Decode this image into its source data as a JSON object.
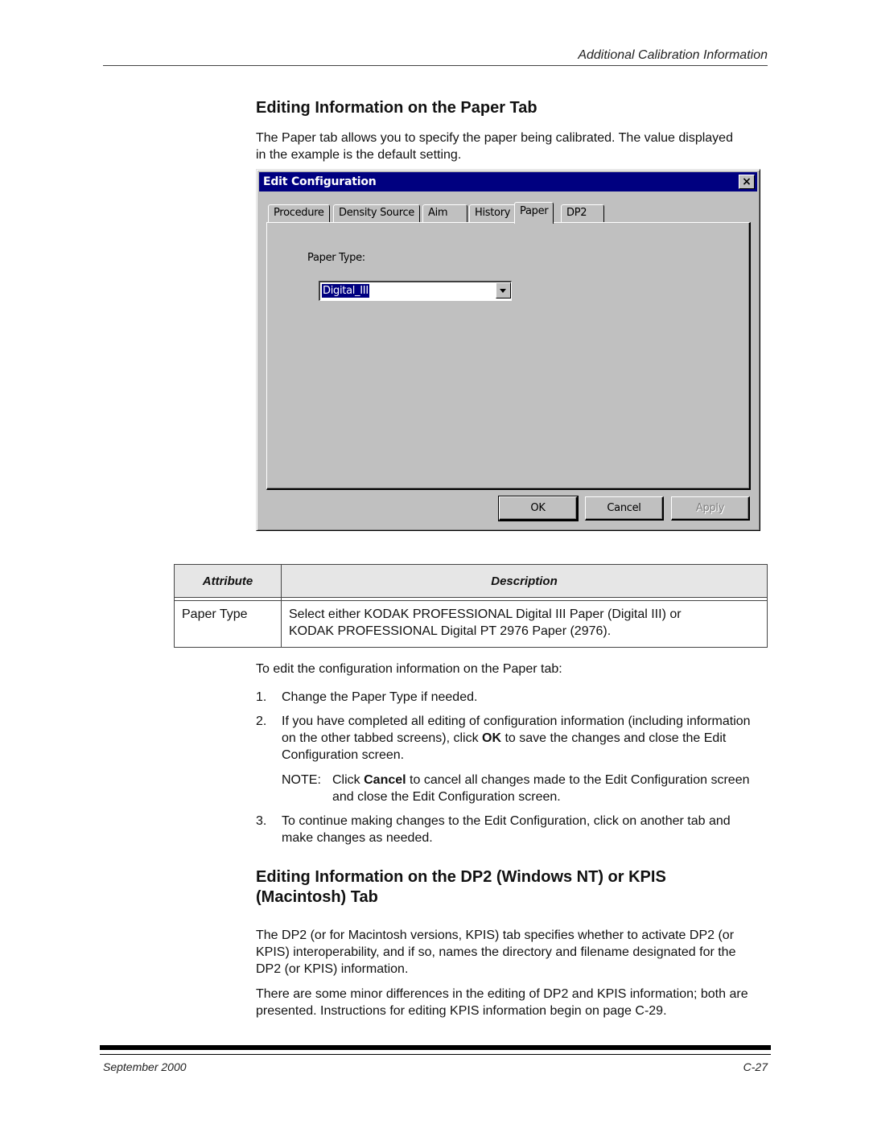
{
  "header": {
    "running_head": "Additional Calibration Information"
  },
  "section1": {
    "heading": "Editing Information on the Paper Tab",
    "intro": "The Paper tab allows you to specify the paper being calibrated. The value displayed in the example is the default setting."
  },
  "dialog": {
    "title": "Edit Configuration",
    "close_glyph": "×",
    "tabs": [
      {
        "label": "Procedure",
        "active": false
      },
      {
        "label": "Density Source",
        "active": false
      },
      {
        "label": "Aim",
        "active": false
      },
      {
        "label": "History",
        "active": false
      },
      {
        "label": "Paper",
        "active": true
      },
      {
        "label": "DP2",
        "active": false
      }
    ],
    "field_label": "Paper Type:",
    "paper_type_value": "Digital_III",
    "buttons": {
      "ok": "OK",
      "cancel": "Cancel",
      "apply": "Apply"
    },
    "colors": {
      "titlebar": "#000080",
      "face": "#c0c0c0",
      "selection": "#000080"
    }
  },
  "attribute_table": {
    "headers": [
      "Attribute",
      "Description"
    ],
    "rows": [
      {
        "attribute": "Paper Type",
        "description_line1": "Select either KODAK PROFESSIONAL Digital III Paper (Digital III) or",
        "description_line2": "KODAK PROFESSIONAL Digital PT 2976 Paper (2976)."
      }
    ]
  },
  "instructions": {
    "lead": "To edit the configuration information on the Paper tab:",
    "steps": [
      {
        "num": "1.",
        "text_before": "Change the Paper Type if needed.",
        "bold": "",
        "text_after": ""
      },
      {
        "num": "2.",
        "text_before": "If you have completed all editing of configuration information (including information on the other tabbed screens), click ",
        "bold": "OK",
        "text_after": " to save the changes and close the Edit Configuration screen."
      },
      {
        "num": "3.",
        "text_before": "To continue making changes to the Edit Configuration, click on another tab and make changes as needed.",
        "bold": "",
        "text_after": ""
      }
    ],
    "note": {
      "label": "NOTE:",
      "text_before": "Click ",
      "bold": "Cancel",
      "text_after": " to cancel all changes made to the Edit Configuration screen and close the Edit Configuration screen."
    }
  },
  "section2": {
    "heading_line1": "Editing Information on the DP2 (Windows NT) or KPIS",
    "heading_line2": "(Macintosh) Tab",
    "para1": "The DP2 (or for Macintosh versions, KPIS) tab specifies whether to activate DP2 (or KPIS) interoperability, and if so, names the directory and filename designated for the DP2 (or KPIS) information.",
    "para2": "There are some minor differences in the editing of DP2 and KPIS information; both are presented. Instructions for editing KPIS information begin on page C-29."
  },
  "footer": {
    "date": "September 2000",
    "page": "C-27"
  }
}
